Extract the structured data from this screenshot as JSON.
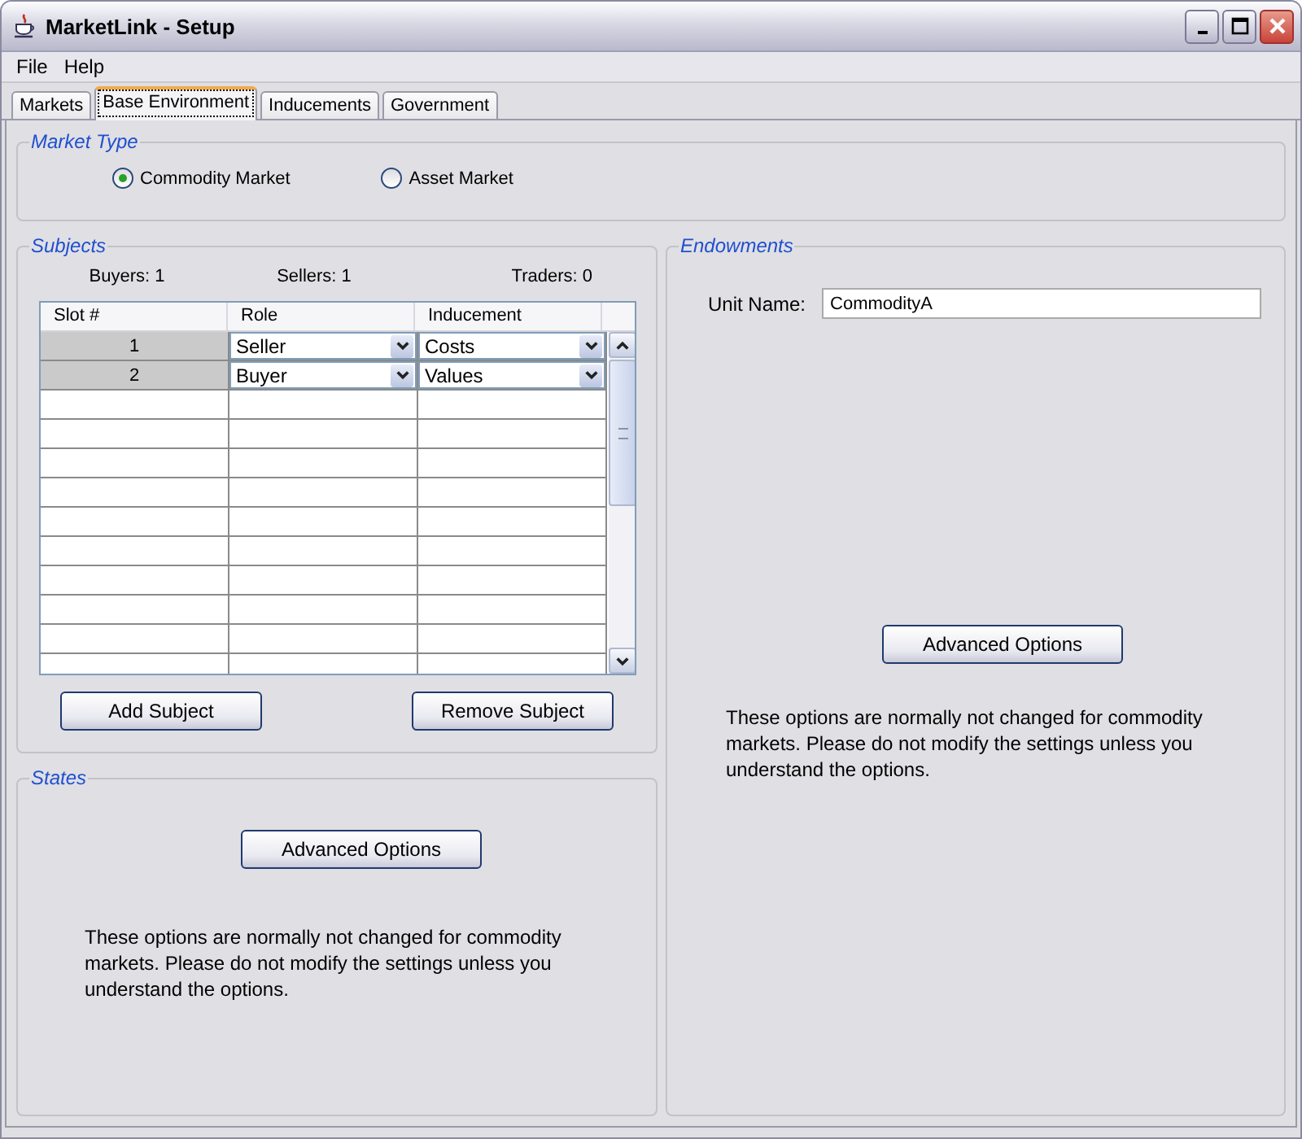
{
  "window": {
    "title": "MarketLink - Setup"
  },
  "menu": [
    "File",
    "Help"
  ],
  "tabs": [
    {
      "label": "Markets",
      "selected": false
    },
    {
      "label": "Base Environment",
      "selected": true
    },
    {
      "label": "Inducements",
      "selected": false
    },
    {
      "label": "Government",
      "selected": false
    }
  ],
  "market_type": {
    "title": "Market Type",
    "options": [
      {
        "label": "Commodity Market",
        "selected": true
      },
      {
        "label": "Asset Market",
        "selected": false
      }
    ]
  },
  "subjects": {
    "title": "Subjects",
    "counts": [
      "Buyers: 1",
      "Sellers: 1",
      "Traders: 0"
    ],
    "columns": [
      "Slot #",
      "Role",
      "Inducement"
    ],
    "rows": [
      {
        "slot": "1",
        "role": "Seller",
        "inducement": "Costs"
      },
      {
        "slot": "2",
        "role": "Buyer",
        "inducement": "Values"
      }
    ],
    "buttons": [
      "Add Subject",
      "Remove Subject"
    ]
  },
  "states": {
    "title": "States",
    "button": "Advanced Options",
    "note": "These options are normally not changed for commodity markets. Please do not modify the settings unless you understand the options."
  },
  "endowments": {
    "title": "Endowments",
    "unit_label": "Unit Name:",
    "unit_value": "CommodityA",
    "button": "Advanced Options",
    "note": "These options are normally not changed for commodity markets. Please do not modify the settings unless you understand the options."
  }
}
